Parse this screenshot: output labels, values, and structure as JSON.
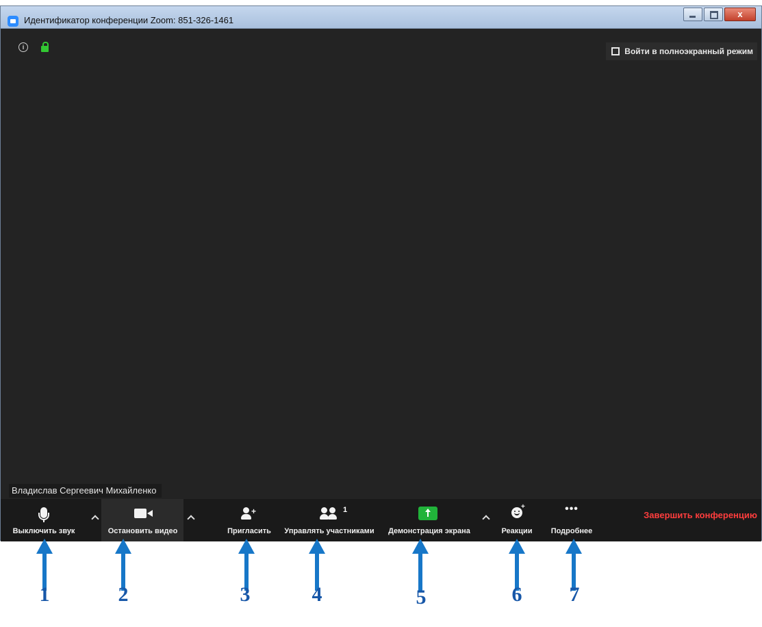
{
  "window": {
    "title": "Идентификатор конференции Zoom: 851-326-1461",
    "close_glyph": "x"
  },
  "video": {
    "participant_name": "Владислав Сергеевич Михайленко",
    "fullscreen_label": "Войти в полноэкранный режим",
    "info_glyph": "i"
  },
  "toolbar": {
    "mute_label": "Выключить звук",
    "stop_video_label": "Остановить видео",
    "invite_label": "Пригласить",
    "manage_participants_label": "Управлять участниками",
    "participants_count": "1",
    "share_screen_label": "Демонстрация экрана",
    "reactions_label": "Реакции",
    "more_label": "Подробнее",
    "more_glyph": "•••",
    "end_meeting_label": "Завершить конференцию"
  },
  "annotations": {
    "numbers": [
      "1",
      "2",
      "3",
      "4",
      "5",
      "6",
      "7"
    ],
    "arrow_color": "#1777c8",
    "number_color": "#1757a8"
  },
  "colors": {
    "end_meeting": "#ff3d3d",
    "share_green": "#21b33a",
    "lock_green": "#32c832",
    "background": "#232323"
  }
}
